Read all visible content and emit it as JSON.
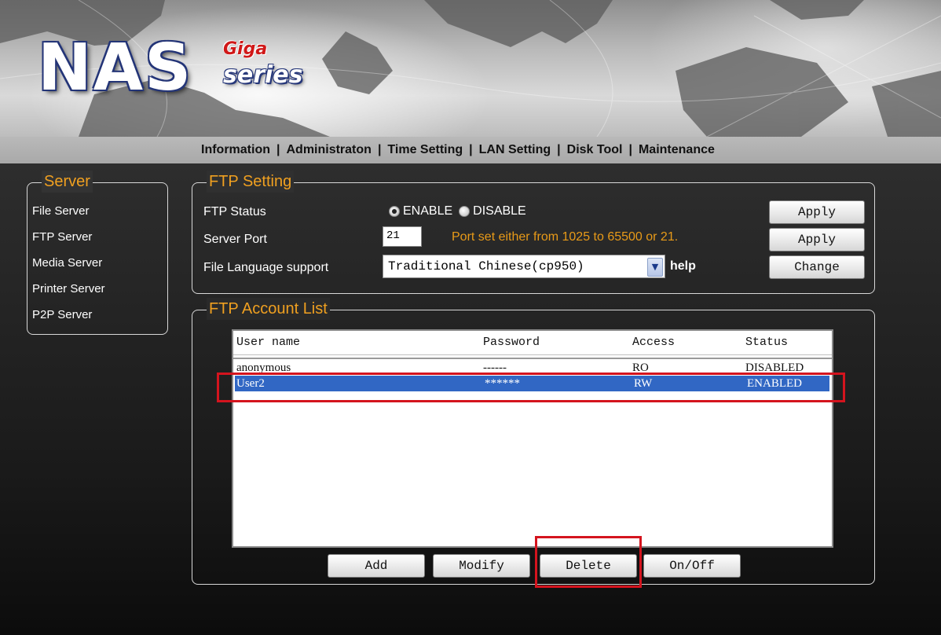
{
  "banner": {
    "logo_main": "NAS",
    "logo_giga": "Giga",
    "logo_series": "series"
  },
  "nav": {
    "items": [
      "Information",
      "Administraton",
      "Time Setting",
      "LAN Setting",
      "Disk Tool",
      "Maintenance"
    ],
    "separator": "|"
  },
  "sidebar": {
    "title": "Server",
    "items": [
      "File Server",
      "FTP Server",
      "Media Server",
      "Printer Server",
      "P2P Server"
    ]
  },
  "ftp_setting": {
    "title": "FTP Setting",
    "status_label": "FTP Status",
    "enable_label": "ENABLE",
    "disable_label": "DISABLE",
    "status_selected": "ENABLE",
    "port_label": "Server Port",
    "port_value": "21",
    "port_hint": "Port set either from 1025 to 65500 or 21.",
    "language_label": "File Language support",
    "language_value": "Traditional Chinese(cp950)",
    "help_label": "help",
    "apply_label": "Apply",
    "change_label": "Change"
  },
  "account_list": {
    "title": "FTP Account List",
    "columns": [
      "User name",
      "Password",
      "Access",
      "Status"
    ],
    "rows": [
      {
        "user": "anonymous",
        "password": "------",
        "access": "RO",
        "status": "DISABLED",
        "selected": false
      },
      {
        "user": "User2",
        "password": "******",
        "access": "RW",
        "status": "ENABLED",
        "selected": true
      }
    ],
    "buttons": {
      "add": "Add",
      "modify": "Modify",
      "delete": "Delete",
      "onoff": "On/Off"
    }
  },
  "colors": {
    "legend_orange": "#f0a020",
    "hint_orange": "#e89a18",
    "selection_blue": "#3167c4",
    "highlight_red": "#d4141e"
  }
}
